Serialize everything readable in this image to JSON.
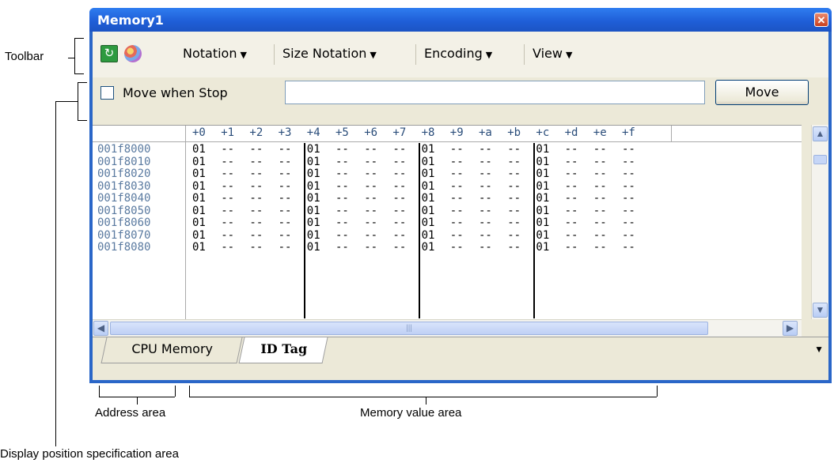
{
  "annotations": {
    "toolbar": "Toolbar",
    "display_position_area": "Display position specification area",
    "address_area": "Address area",
    "memory_value_area": "Memory value area"
  },
  "window": {
    "title": "Memory1",
    "close_glyph": "✕"
  },
  "toolbar": {
    "icons": [
      "refresh-icon",
      "palette-icon"
    ],
    "menus": [
      "Notation",
      "Size Notation",
      "Encoding",
      "View"
    ]
  },
  "position_bar": {
    "checkbox_label": "Move when Stop",
    "checkbox_checked": false,
    "address_value": "",
    "move_button": "Move"
  },
  "grid": {
    "column_headers": [
      "+0",
      "+1",
      "+2",
      "+3",
      "+4",
      "+5",
      "+6",
      "+7",
      "+8",
      "+9",
      "+a",
      "+b",
      "+c",
      "+d",
      "+e",
      "+f"
    ],
    "rows": [
      {
        "address": "001f8000",
        "values": [
          "01",
          "--",
          "--",
          "--",
          "01",
          "--",
          "--",
          "--",
          "01",
          "--",
          "--",
          "--",
          "01",
          "--",
          "--",
          "--"
        ]
      },
      {
        "address": "001f8010",
        "values": [
          "01",
          "--",
          "--",
          "--",
          "01",
          "--",
          "--",
          "--",
          "01",
          "--",
          "--",
          "--",
          "01",
          "--",
          "--",
          "--"
        ]
      },
      {
        "address": "001f8020",
        "values": [
          "01",
          "--",
          "--",
          "--",
          "01",
          "--",
          "--",
          "--",
          "01",
          "--",
          "--",
          "--",
          "01",
          "--",
          "--",
          "--"
        ]
      },
      {
        "address": "001f8030",
        "values": [
          "01",
          "--",
          "--",
          "--",
          "01",
          "--",
          "--",
          "--",
          "01",
          "--",
          "--",
          "--",
          "01",
          "--",
          "--",
          "--"
        ]
      },
      {
        "address": "001f8040",
        "values": [
          "01",
          "--",
          "--",
          "--",
          "01",
          "--",
          "--",
          "--",
          "01",
          "--",
          "--",
          "--",
          "01",
          "--",
          "--",
          "--"
        ]
      },
      {
        "address": "001f8050",
        "values": [
          "01",
          "--",
          "--",
          "--",
          "01",
          "--",
          "--",
          "--",
          "01",
          "--",
          "--",
          "--",
          "01",
          "--",
          "--",
          "--"
        ]
      },
      {
        "address": "001f8060",
        "values": [
          "01",
          "--",
          "--",
          "--",
          "01",
          "--",
          "--",
          "--",
          "01",
          "--",
          "--",
          "--",
          "01",
          "--",
          "--",
          "--"
        ]
      },
      {
        "address": "001f8070",
        "values": [
          "01",
          "--",
          "--",
          "--",
          "01",
          "--",
          "--",
          "--",
          "01",
          "--",
          "--",
          "--",
          "01",
          "--",
          "--",
          "--"
        ]
      },
      {
        "address": "001f8080",
        "values": [
          "01",
          "--",
          "--",
          "--",
          "01",
          "--",
          "--",
          "--",
          "01",
          "--",
          "--",
          "--",
          "01",
          "--",
          "--",
          "--"
        ]
      }
    ]
  },
  "tabs": [
    "CPU Memory",
    "ID Tag"
  ],
  "active_tab": "ID Tag",
  "scroll": {
    "up": "▲",
    "down": "▼",
    "left": "◀",
    "right": "▶",
    "hthumb_grip": "|||"
  }
}
